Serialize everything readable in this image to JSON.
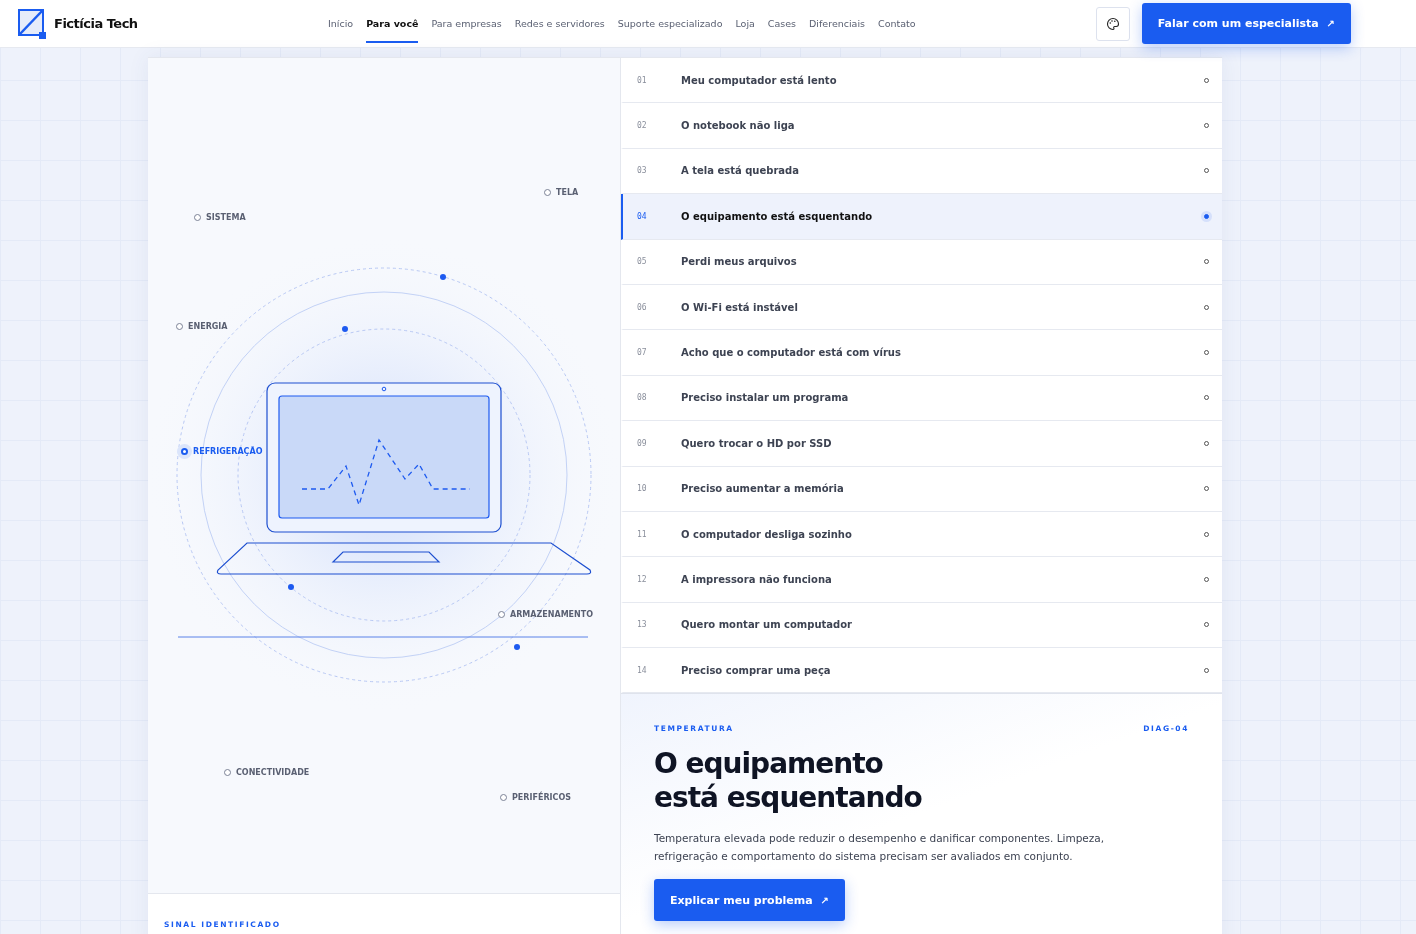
{
  "header": {
    "brand": "Fictícia Tech",
    "nav": [
      {
        "label": "Início",
        "selected": false
      },
      {
        "label": "Para você",
        "selected": true
      },
      {
        "label": "Para empresas",
        "selected": false
      },
      {
        "label": "Redes e servidores",
        "selected": false
      },
      {
        "label": "Suporte especializado",
        "selected": false
      },
      {
        "label": "Loja",
        "selected": false
      },
      {
        "label": "Cases",
        "selected": false
      },
      {
        "label": "Diferenciais",
        "selected": false
      },
      {
        "label": "Contato",
        "selected": false
      }
    ],
    "cta": "Falar com um especialista",
    "cta_icon": "↗"
  },
  "diagram": {
    "nodes": [
      {
        "label": "TELA",
        "selected": false
      },
      {
        "label": "SISTEMA",
        "selected": false
      },
      {
        "label": "ENERGIA",
        "selected": false
      },
      {
        "label": "REFRIGERAÇÃO",
        "selected": true
      },
      {
        "label": "ARMAZENAMENTO",
        "selected": false
      },
      {
        "label": "CONECTIVIDADE",
        "selected": false
      },
      {
        "label": "PERIFÉRICOS",
        "selected": false
      }
    ],
    "signal_label": "SINAL IDENTIFICADO"
  },
  "problems": [
    {
      "number": "01",
      "label": "Meu computador está lento",
      "selected": false
    },
    {
      "number": "02",
      "label": "O notebook não liga",
      "selected": false
    },
    {
      "number": "03",
      "label": "A tela está quebrada",
      "selected": false
    },
    {
      "number": "04",
      "label": "O equipamento está esquentando",
      "selected": true
    },
    {
      "number": "05",
      "label": "Perdi meus arquivos",
      "selected": false
    },
    {
      "number": "06",
      "label": "O Wi-Fi está instável",
      "selected": false
    },
    {
      "number": "07",
      "label": "Acho que o computador está com vírus",
      "selected": false
    },
    {
      "number": "08",
      "label": "Preciso instalar um programa",
      "selected": false
    },
    {
      "number": "09",
      "label": "Quero trocar o HD por SSD",
      "selected": false
    },
    {
      "number": "10",
      "label": "Preciso aumentar a memória",
      "selected": false
    },
    {
      "number": "11",
      "label": "O computador desliga sozinho",
      "selected": false
    },
    {
      "number": "12",
      "label": "A impressora não funciona",
      "selected": false
    },
    {
      "number": "13",
      "label": "Quero montar um computador",
      "selected": false
    },
    {
      "number": "14",
      "label": "Preciso comprar uma peça",
      "selected": false
    }
  ],
  "detail": {
    "category": "TEMPERATURA",
    "code": "DIAG-04",
    "title_lines": [
      "O equipamento",
      "está esquentando"
    ],
    "description": "Temperatura elevada pode reduzir o desempenho e danificar componentes. Limpeza, refrigeração e comportamento do sistema precisam ser avaliados em conjunto.",
    "button": "Explicar meu problema",
    "button_icon": "↗"
  }
}
